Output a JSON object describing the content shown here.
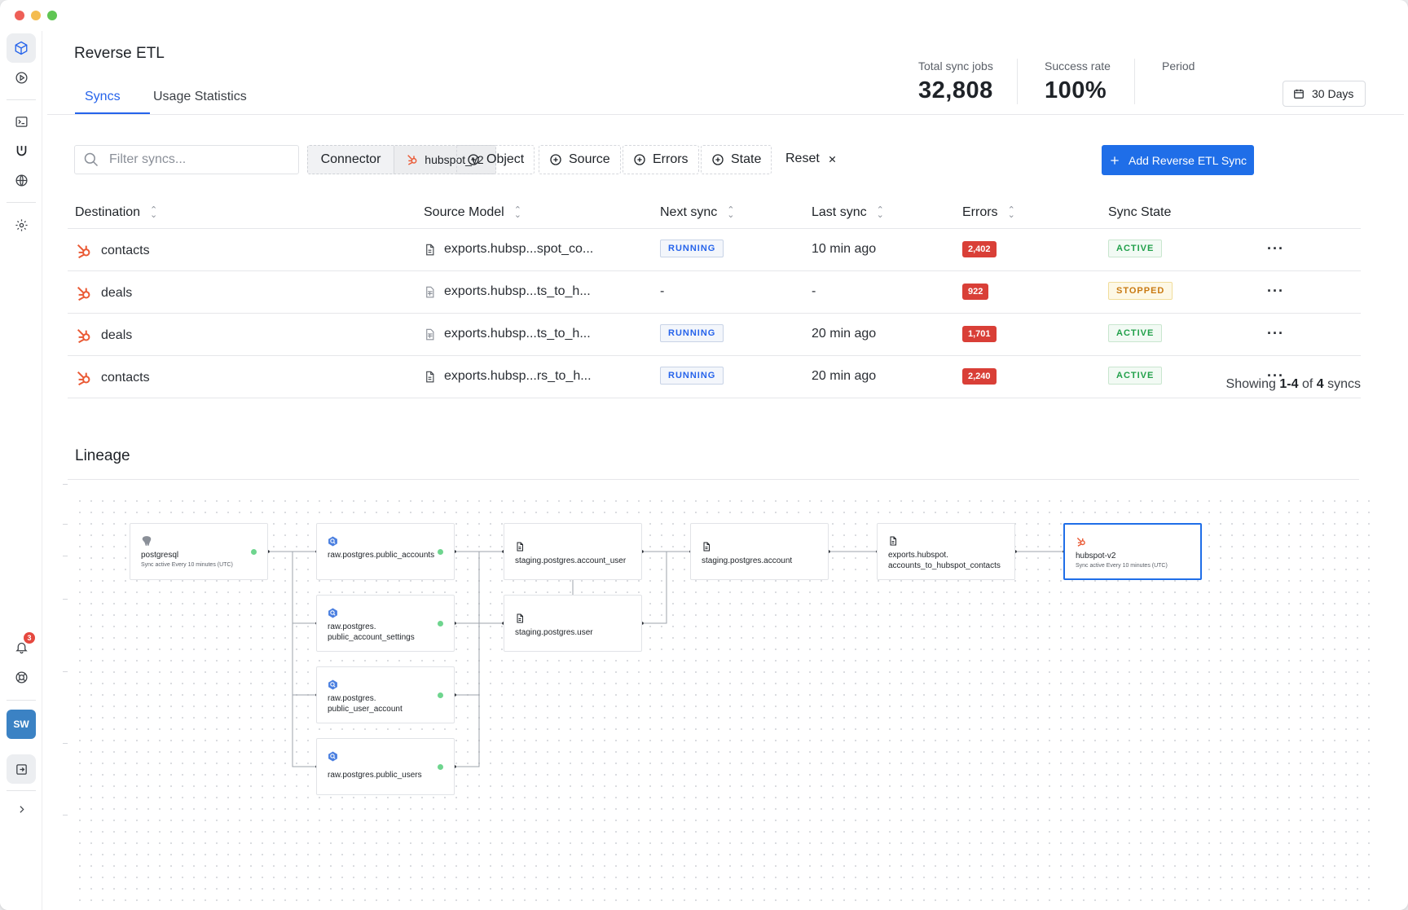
{
  "app": {
    "title": "Reverse ETL"
  },
  "tabs": [
    {
      "label": "Syncs",
      "active": true
    },
    {
      "label": "Usage Statistics",
      "active": false
    }
  ],
  "stats": {
    "total_label": "Total sync jobs",
    "total_value": "32,808",
    "success_label": "Success rate",
    "success_value": "100%",
    "period_label": "Period",
    "period_value": "30 Days"
  },
  "filters": {
    "search_placeholder": "Filter syncs...",
    "connector_label": "Connector",
    "connector_value": "hubspot_v2",
    "object_label": "Object",
    "source_label": "Source",
    "errors_label": "Errors",
    "state_label": "State",
    "reset_label": "Reset",
    "add_button": "Add Reverse ETL Sync"
  },
  "table": {
    "headers": {
      "destination": "Destination",
      "source_model": "Source Model",
      "next_sync": "Next sync",
      "last_sync": "Last sync",
      "errors": "Errors",
      "sync_state": "Sync State"
    },
    "rows": [
      {
        "destination": "contacts",
        "source_model": "exports.hubsp...spot_co...",
        "next_sync": "RUNNING",
        "last_sync": "10 min ago",
        "errors": "2,402",
        "state": "ACTIVE"
      },
      {
        "destination": "deals",
        "source_model": "exports.hubsp...ts_to_h...",
        "next_sync": "-",
        "last_sync": "-",
        "errors": "922",
        "state": "STOPPED"
      },
      {
        "destination": "deals",
        "source_model": "exports.hubsp...ts_to_h...",
        "next_sync": "RUNNING",
        "last_sync": "20 min ago",
        "errors": "1,701",
        "state": "ACTIVE"
      },
      {
        "destination": "contacts",
        "source_model": "exports.hubsp...rs_to_h...",
        "next_sync": "RUNNING",
        "last_sync": "20 min ago",
        "errors": "2,240",
        "state": "ACTIVE"
      }
    ],
    "showing_prefix": "Showing",
    "showing_range": "1-4",
    "showing_of": "of",
    "showing_total": "4",
    "showing_suffix": "syncs"
  },
  "lineage": {
    "title": "Lineage",
    "nodes": {
      "postgres": {
        "title": "postgresql",
        "sub": "Sync active  Every 10 minutes (UTC)"
      },
      "raw_accounts": {
        "title": "raw.postgres.public_accounts"
      },
      "raw_settings_1": {
        "title": "raw.postgres."
      },
      "raw_settings_2": {
        "title": "public_account_settings"
      },
      "raw_user_account_1": {
        "title": "raw.postgres."
      },
      "raw_user_account_2": {
        "title": "public_user_account"
      },
      "raw_users": {
        "title": "raw.postgres.public_users"
      },
      "stg_account_user": {
        "title": "staging.postgres.account_user"
      },
      "stg_user": {
        "title": "staging.postgres.user"
      },
      "stg_account": {
        "title": "staging.postgres.account"
      },
      "exports_1": {
        "title": "exports.hubspot."
      },
      "exports_2": {
        "title": "accounts_to_hubspot_contacts"
      },
      "hubspot": {
        "title": "hubspot-v2",
        "sub": "Sync active  Every 10 minutes (UTC)"
      }
    }
  },
  "sidebar": {
    "notification_count": "3",
    "avatar": "SW"
  },
  "colors": {
    "accent": "#1f6ee8",
    "hubspot": "#ea5a35",
    "error": "#d93f37",
    "active": "#21a04a",
    "stopped": "#c97a12"
  }
}
